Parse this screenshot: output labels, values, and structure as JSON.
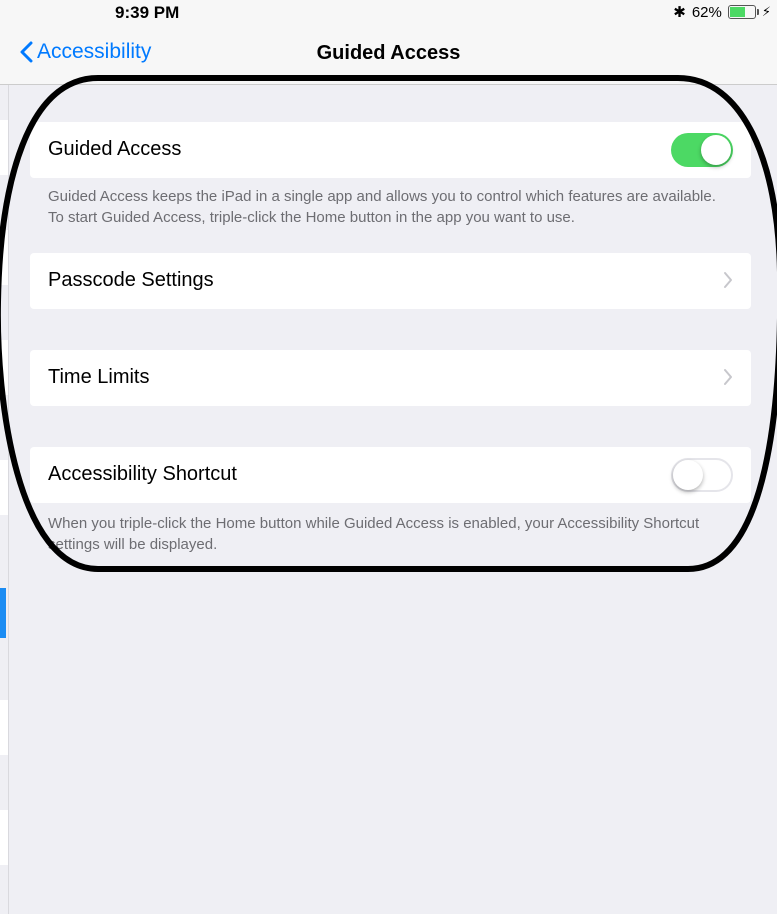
{
  "status_bar": {
    "time": "9:39 PM",
    "battery_percent": "62%",
    "battery_level": 0.62
  },
  "nav": {
    "back_label": "Accessibility",
    "title": "Guided Access"
  },
  "settings": {
    "guided_access": {
      "label": "Guided Access",
      "enabled": true
    },
    "guided_access_footer": "Guided Access keeps the iPad in a single app and allows you to control which features are available. To start Guided Access, triple-click the Home button in the app you want to use.",
    "passcode_settings": {
      "label": "Passcode Settings"
    },
    "time_limits": {
      "label": "Time Limits"
    },
    "accessibility_shortcut": {
      "label": "Accessibility Shortcut",
      "enabled": false
    },
    "accessibility_shortcut_footer": "When you triple-click the Home button while Guided Access is enabled, your Accessibility Shortcut settings will be displayed."
  },
  "colors": {
    "accent": "#007aff",
    "toggle_on": "#4cd964",
    "background": "#efeff4",
    "annotation": "#000000"
  }
}
